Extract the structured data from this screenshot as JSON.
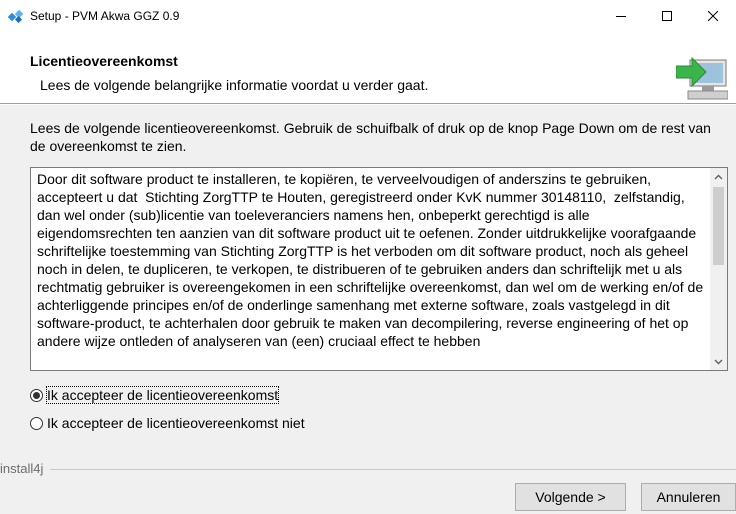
{
  "window": {
    "title": "Setup - PVM Akwa GGZ 0.9",
    "controls": {
      "minimize": "minimize-icon",
      "maximize": "maximize-icon",
      "close": "close-icon"
    }
  },
  "header": {
    "title": "Licentieovereenkomst",
    "subtitle": "Lees de volgende belangrijke informatie voordat u verder gaat.",
    "icon": "install-computer-arrow-icon"
  },
  "content": {
    "intro": "Lees de volgende licentieovereenkomst. Gebruik de schuifbalk of druk op de knop Page Down om de rest van de overeenkomst te zien.",
    "license_text": "Door dit software product te installeren, te kopiëren, te verveelvoudigen of anderszins te gebruiken, accepteert u dat  Stichting ZorgTTP te Houten, geregistreerd onder KvK nummer 30148110,  zelfstandig, dan wel onder (sub)licentie van toeleveranciers namens hen, onbeperkt gerechtigd is alle eigendomsrechten ten aanzien van dit software product uit te oefenen. Zonder uitdrukkelijke voorafgaande schriftelijke toestemming van Stichting ZorgTTP is het verboden om dit software product, noch als geheel noch in delen, te dupliceren, te verkopen, te distribueren of te gebruiken anders dan schriftelijk met u als rechtmatig gebruiker is overeengekomen in een schriftelijke overeenkomst, dan wel om de werking en/of de achterliggende principes en/of de onderlinge samenhang met externe software, zoals vastgelegd in dit software-product, te achterhalen door gebruik te maken van decompilering, reverse engineering of het op andere wijze ontleden of analyseren van (een) cruciaal effect te hebben",
    "radio_accept": "Ik accepteer de licentieovereenkomst",
    "radio_decline": "Ik accepteer de licentieovereenkomst niet",
    "accept_selected": true
  },
  "footer": {
    "brand": "install4j",
    "next_label": "Volgende >",
    "cancel_label": "Annuleren"
  }
}
